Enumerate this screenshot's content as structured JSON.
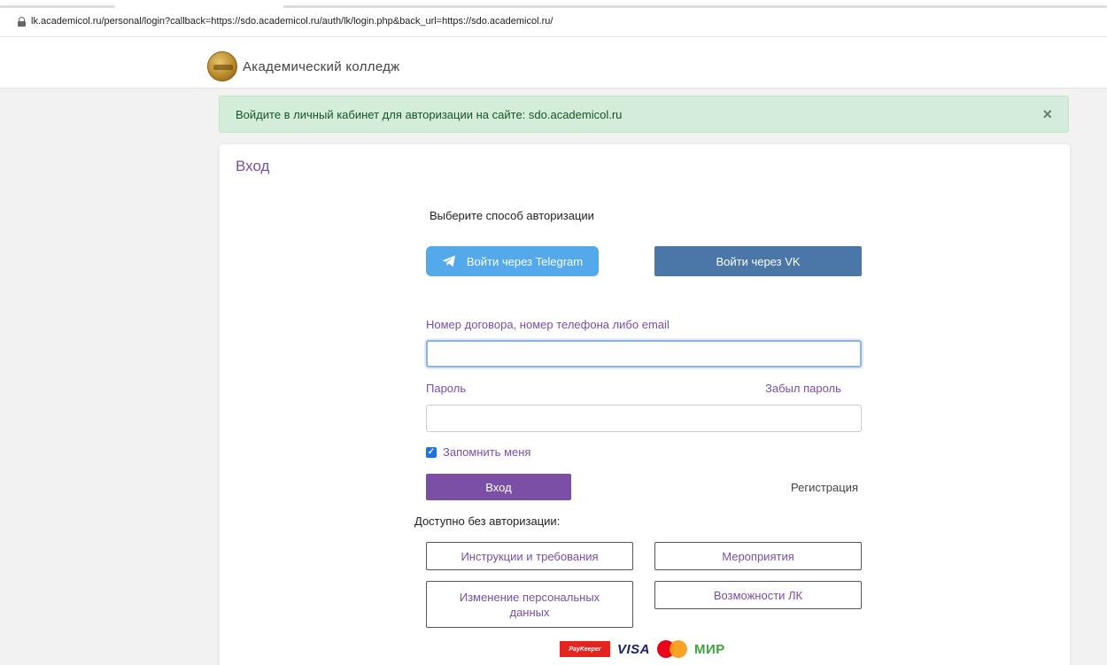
{
  "browser": {
    "url": "lk.academicol.ru/personal/login?callback=https://sdo.academicol.ru/auth/lk/login.php&back_url=https://sdo.academicol.ru/"
  },
  "header": {
    "logo_text": "Академический колледж"
  },
  "alert": {
    "message": "Войдите в личный кабинет для авторизации на сайте: sdo.academicol.ru",
    "close_symbol": "×"
  },
  "card": {
    "title": "Вход",
    "auth_caption": "Выберите способ авторизации",
    "telegram_label": "Войти через Telegram",
    "vk_label": "Войти через VK",
    "login_label": "Номер договора, номер телефона либо email",
    "login_value": "",
    "password_label": "Пароль",
    "password_value": "",
    "forgot_label": "Забыл пароль",
    "remember_label": "Запомнить меня",
    "remember_checked": true,
    "submit_label": "Вход",
    "register_label": "Регистрация",
    "no_auth_caption": "Доступно без авторизации:",
    "links": {
      "instructions": "Инструкции и требования",
      "events": "Мероприятия",
      "personal_data": "Изменение персональных данных",
      "features": "Возможности ЛК"
    }
  },
  "payments": {
    "paykeeper": "PayKeeper",
    "visa": "VISA",
    "mir": "МИР"
  },
  "colors": {
    "accent": "#7a4fa5",
    "telegram": "#54a9eb",
    "vk": "#4a76a8",
    "alert_bg": "#d4edda"
  }
}
